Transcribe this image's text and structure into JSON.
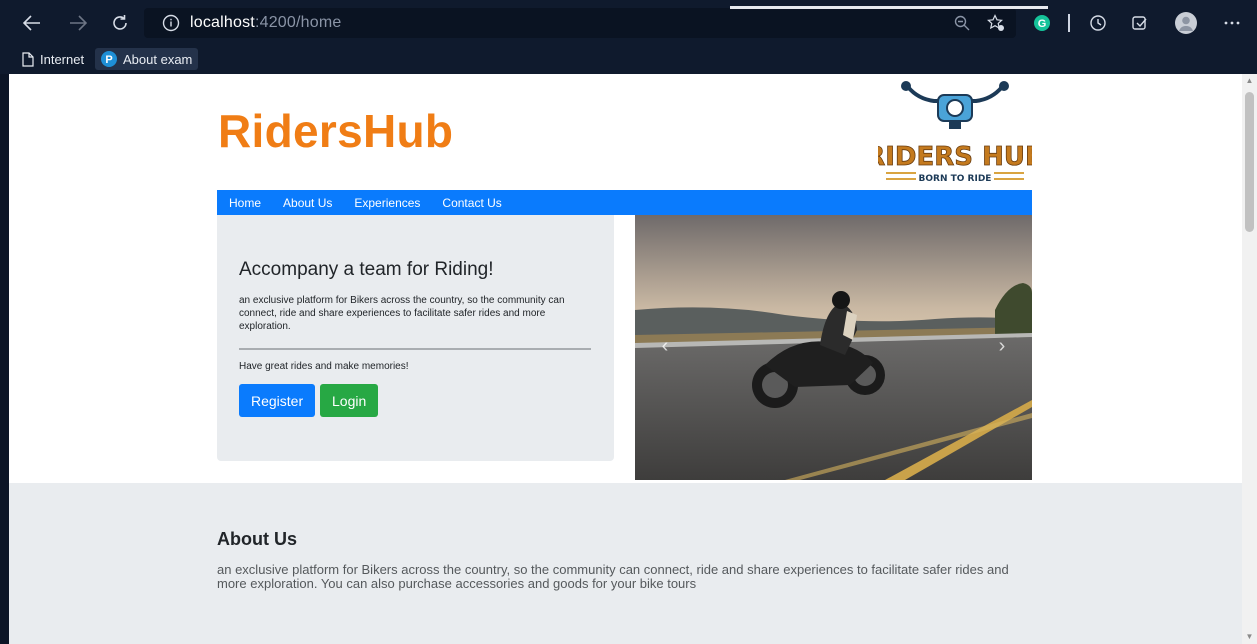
{
  "browser": {
    "url_host": "localhost",
    "url_path": ":4200/home",
    "bookmarks": [
      {
        "label": "Internet"
      },
      {
        "label": "About exam"
      }
    ],
    "profile_badge": "G"
  },
  "site": {
    "brand": "RidersHub",
    "logo": {
      "line1": "RIDERS HUB",
      "line2": "BORN TO RIDE"
    },
    "nav": [
      {
        "label": "Home"
      },
      {
        "label": "About Us"
      },
      {
        "label": "Experiences"
      },
      {
        "label": "Contact Us"
      }
    ],
    "hero": {
      "title": "Accompany a team for Riding!",
      "description": "an exclusive platform for Bikers across the country, so the community can connect, ride and share experiences to facilitate safer rides and more exploration.",
      "tagline": "Have great rides and make memories!",
      "register_label": "Register",
      "login_label": "Login"
    },
    "carousel": {
      "prev_glyph": "‹",
      "next_glyph": "›"
    },
    "about": {
      "title": "About Us",
      "text": "an exclusive platform for Bikers across the country, so the community can connect, ride and share experiences to facilitate safer rides and more exploration. You can also purchase accessories and goods for your bike tours"
    }
  },
  "colors": {
    "brand_orange": "#f07d15",
    "nav_blue": "#0a7bfd",
    "login_green": "#27a844",
    "card_gray": "#e9ecef"
  }
}
